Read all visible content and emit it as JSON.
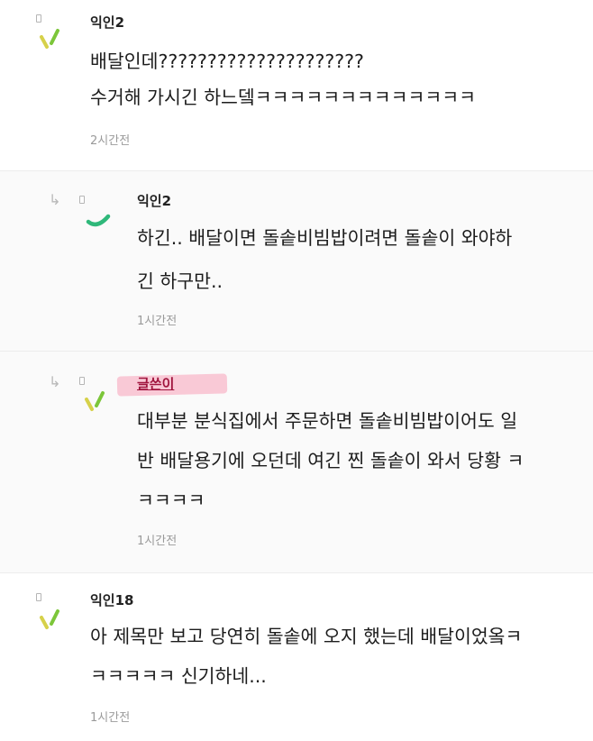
{
  "comments": [
    {
      "author": "익인2",
      "lines": [
        "배달인데?????????????????????",
        "수거해 가시긴 하느뎈ㅋㅋㅋㅋㅋㅋㅋㅋㅋㅋㅋㅋㅋ"
      ],
      "time": "2시간전",
      "is_reply": false,
      "avatar_icon": "green-tick-marks-icon"
    },
    {
      "author": "익인2",
      "lines": [
        "하긴.. 배달이면 돌솥비빔밥이려면 돌솥이 와야하",
        "긴 하구만.."
      ],
      "time": "1시간전",
      "is_reply": true,
      "avatar_icon": "green-arc-icon"
    },
    {
      "author": "글쓴이",
      "lines": [
        "대부분 분식집에서 주문하면 돌솥비빔밥이어도 일",
        "반 배달용기에 오던데 여긴 찐 돌솥이 와서 당황 ㅋ",
        "ㅋㅋㅋㅋ"
      ],
      "time": "1시간전",
      "is_reply": true,
      "is_writer": true,
      "avatar_icon": "green-tick-marks-icon"
    },
    {
      "author": "익인18",
      "lines": [
        "아 제목만 보고 당연히 돌솥에 오지 했는데 배달이었옼ㅋ",
        "ㅋㅋㅋㅋㅋ 신기하네..."
      ],
      "time": "1시간전",
      "is_reply": false,
      "avatar_icon": "green-tick-marks-icon"
    }
  ],
  "colors": {
    "avatar_green": "#7cc63a",
    "avatar_yellow": "#d6d14a",
    "arc_green": "#2fb87a",
    "writer_name": "#a0153e",
    "writer_highlight": "#f9c9d6"
  },
  "icons": {
    "reply_arrow": "↳",
    "dot": "small-square-icon"
  }
}
